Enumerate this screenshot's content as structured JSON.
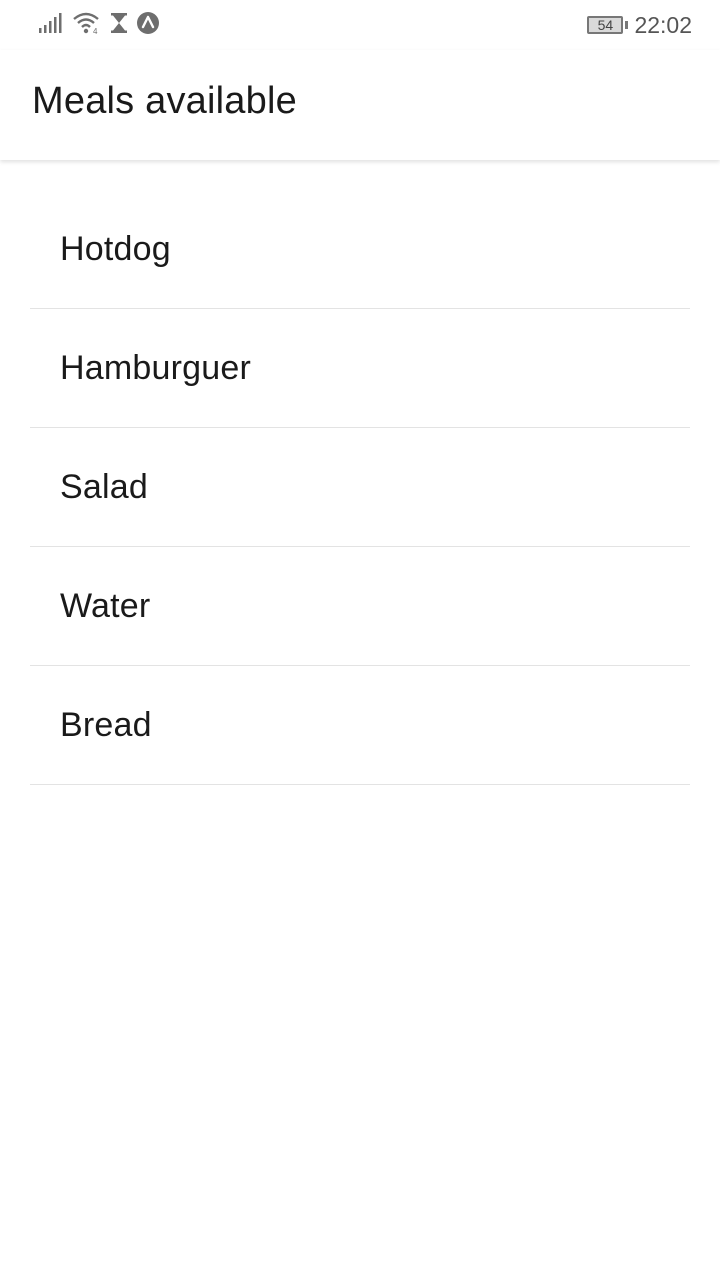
{
  "status_bar": {
    "icons": [
      "signal-icon",
      "wifi-icon",
      "hourglass-icon",
      "app-notification-icon"
    ],
    "battery_level": "54",
    "time": "22:02"
  },
  "header": {
    "title": "Meals available"
  },
  "meals": [
    {
      "label": "Hotdog"
    },
    {
      "label": "Hamburguer"
    },
    {
      "label": "Salad"
    },
    {
      "label": "Water"
    },
    {
      "label": "Bread"
    }
  ]
}
